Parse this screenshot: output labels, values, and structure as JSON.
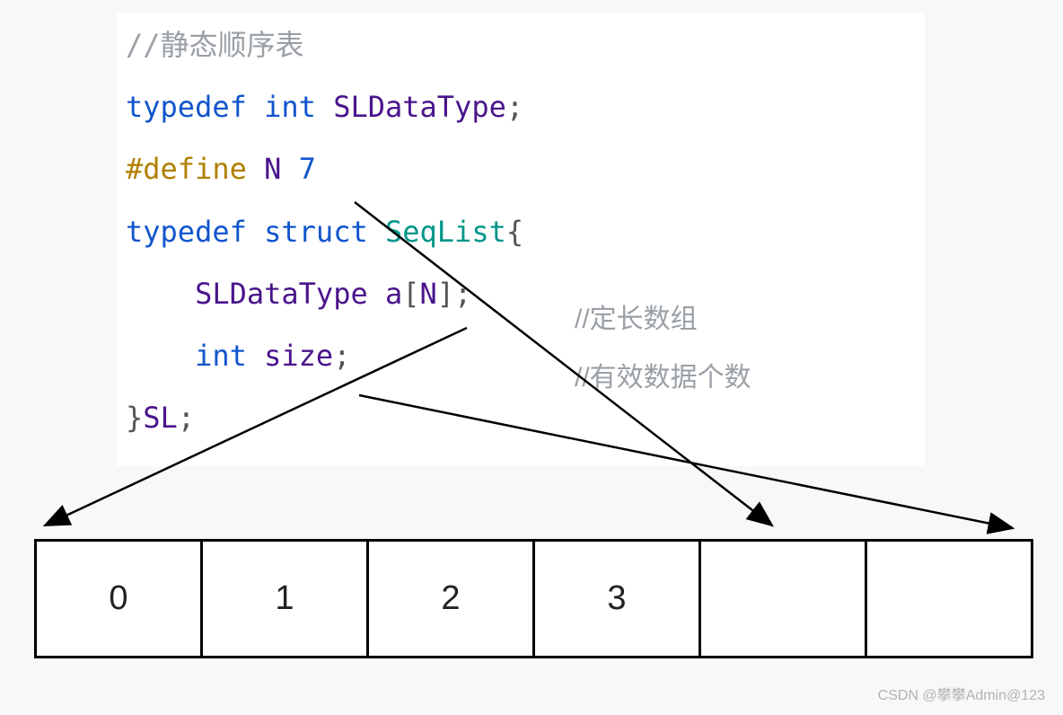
{
  "code": {
    "line1_comment": "//静态顺序表",
    "line2_typedef": "typedef",
    "line2_int": "int",
    "line2_type": "SLDataType",
    "line2_semi": ";",
    "line3_define": "#define",
    "line3_macro": "N",
    "line3_value": "7",
    "line4_typedef": "typedef",
    "line4_struct": "struct",
    "line4_name": "SeqList",
    "line4_brace": "{",
    "line5_indent": "    ",
    "line5_type": "SLDataType",
    "line5_field": "a",
    "line5_lbr": "[",
    "line5_N": "N",
    "line5_rbr": "]",
    "line5_semi": ";",
    "line6_indent": "    ",
    "line6_int": "int",
    "line6_field": "size",
    "line6_semi": ";",
    "line7_close": "}",
    "line7_alias": "SL",
    "line7_semi": ";"
  },
  "side_comments": {
    "fixed_array": "//定长数组",
    "valid_count": "//有效数据个数"
  },
  "array_cells": [
    "0",
    "1",
    "2",
    "3",
    "",
    ""
  ],
  "watermark": "CSDN @攀攀Admin@123"
}
